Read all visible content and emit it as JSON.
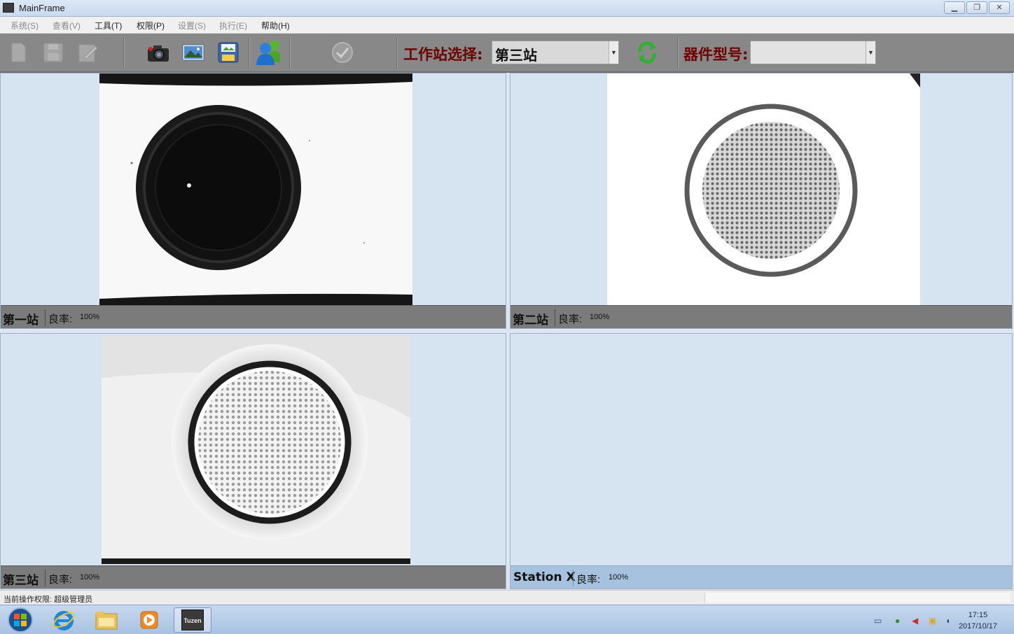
{
  "window": {
    "title": "MainFrame",
    "app_icon": "tuzen-app-icon",
    "controls": [
      "minimize",
      "restore",
      "close"
    ]
  },
  "menu": {
    "items": [
      {
        "label": "系统(S)",
        "enabled": false
      },
      {
        "label": "查看(V)",
        "enabled": false
      },
      {
        "label": "工具(T)",
        "enabled": true
      },
      {
        "label": "权限(P)",
        "enabled": true
      },
      {
        "label": "设置(S)",
        "enabled": false
      },
      {
        "label": "执行(E)",
        "enabled": false
      },
      {
        "label": "帮助(H)",
        "enabled": true
      }
    ]
  },
  "toolbar": {
    "icons": [
      "new-file-icon",
      "save-icon",
      "edit-icon",
      "camera-icon",
      "image-icon",
      "save-image-icon",
      "users-icon",
      "confirm-check-icon",
      "refresh-icon"
    ],
    "station_label": "工作站选择:",
    "station_value": "第三站",
    "part_label": "器件型号:",
    "part_value": ""
  },
  "panels": [
    {
      "name": "第一站",
      "rate_label": "良率:",
      "rate": "100%",
      "image": "dark-lens-image"
    },
    {
      "name": "第二站",
      "rate_label": "良率:",
      "rate": "100%",
      "image": "mesh-lens-image"
    },
    {
      "name": "第三站",
      "rate_label": "良率:",
      "rate": "100%",
      "image": "white-mesh-lens-image"
    },
    {
      "name": "Station X",
      "rate_label": "良率:",
      "rate": "100%",
      "image": ""
    }
  ],
  "status": {
    "permission": "当前操作权限: 超级管理员"
  },
  "taskbar": {
    "apps": [
      "start-orb-icon",
      "internet-explorer-icon",
      "file-explorer-icon",
      "media-player-icon",
      "tuzen-app-icon"
    ],
    "active_app_label": "Tuzen",
    "time": "17:15",
    "date": "2017/10/17"
  },
  "colors": {
    "toolbar_bg": "#888888",
    "label_red": "#6e0000",
    "panel_bg": "#d6e3f1",
    "panel_bar": "#7b7b7b",
    "panel_bar_inactive": "#a7c2df"
  }
}
